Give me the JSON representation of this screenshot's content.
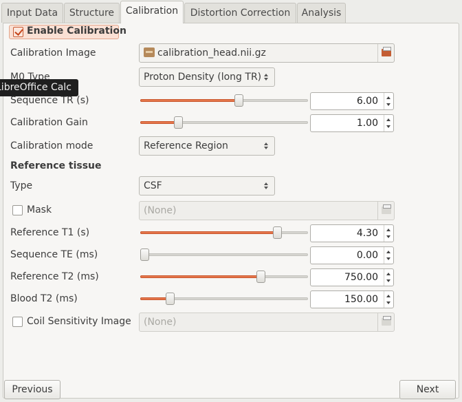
{
  "tabs": [
    {
      "label": "Input Data"
    },
    {
      "label": "Structure"
    },
    {
      "label": "Calibration"
    },
    {
      "label": "Distortion Correction"
    },
    {
      "label": "Analysis"
    }
  ],
  "active_tab": "Calibration",
  "enable_calibration": {
    "label": "Enable Calibration",
    "checked": true
  },
  "calibration_image": {
    "label": "Calibration Image",
    "value": "calibration_head.nii.gz",
    "icon": "folder-icon"
  },
  "m0_type": {
    "label": "M0 Type",
    "value": "Proton Density (long TR)"
  },
  "tooltip": {
    "text": "LibreOffice Calc"
  },
  "sequence_tr": {
    "label": "Sequence TR (s)",
    "value": "6.00",
    "slider_fraction": 0.59
  },
  "calibration_gain": {
    "label": "Calibration Gain",
    "value": "1.00",
    "slider_fraction": 0.21
  },
  "calibration_mode": {
    "label": "Calibration mode",
    "value": "Reference Region"
  },
  "reference_tissue": {
    "heading": "Reference tissue"
  },
  "type": {
    "label": "Type",
    "value": "CSF"
  },
  "mask": {
    "label": "Mask",
    "checked": false,
    "value": "(None)"
  },
  "reference_t1": {
    "label": "Reference T1 (s)",
    "value": "4.30",
    "slider_fraction": 0.83
  },
  "sequence_te": {
    "label": "Sequence TE (ms)",
    "value": "0.00",
    "slider_fraction": 0.0
  },
  "reference_t2": {
    "label": "Reference T2 (ms)",
    "value": "750.00",
    "slider_fraction": 0.73
  },
  "blood_t2": {
    "label": "Blood T2 (ms)",
    "value": "150.00",
    "slider_fraction": 0.16
  },
  "coil_sensitivity": {
    "label": "Coil Sensitivity Image",
    "checked": false,
    "value": "(None)"
  },
  "footer": {
    "previous_label": "Previous",
    "next_label": "Next"
  },
  "colors": {
    "accent": "#e5764b",
    "background": "#f7f6f4"
  }
}
